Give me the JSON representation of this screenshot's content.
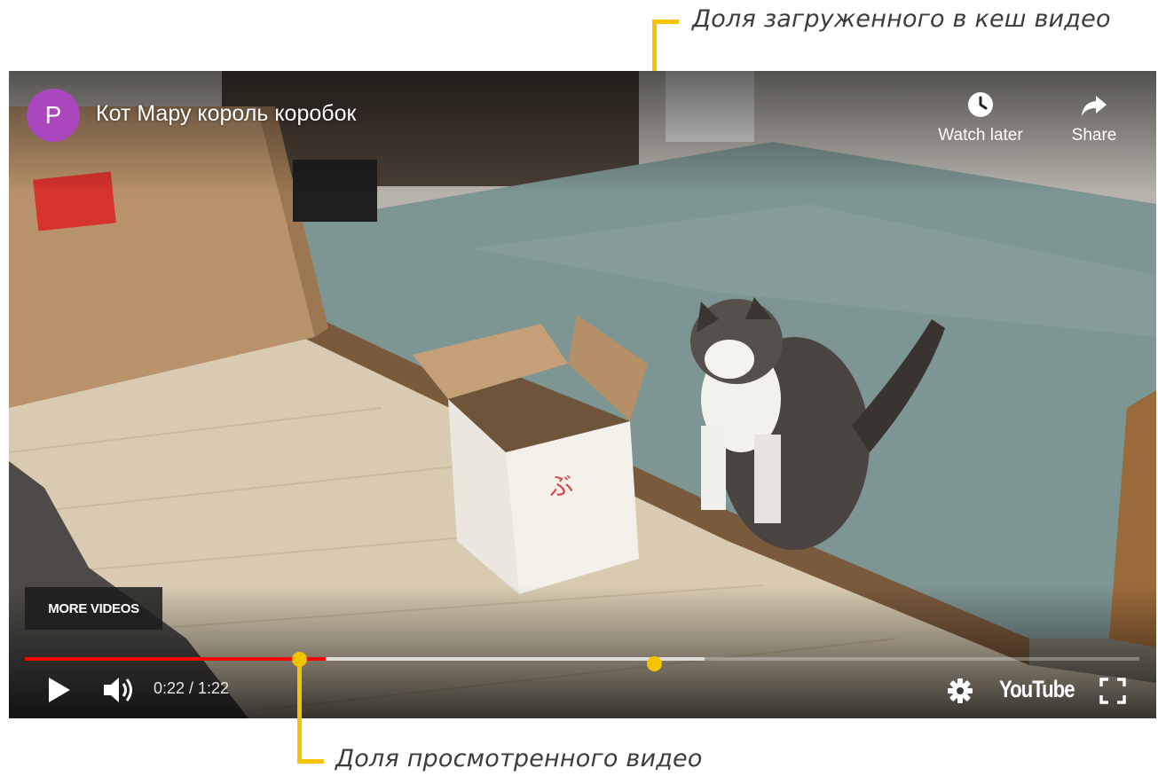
{
  "annotations": {
    "cached_label": "Доля загруженного в кеш видео",
    "watched_label": "Доля просмотренного видео",
    "color": "#f5c400"
  },
  "player": {
    "channel_initial": "P",
    "avatar_color": "#ab47bc",
    "title": "Кот Мару король коробок",
    "watch_later_label": "Watch later",
    "watch_later_icon": "clock-icon",
    "share_label": "Share",
    "share_icon": "share-arrow-icon",
    "more_videos_label": "MORE VIDEOS",
    "progress": {
      "played_fraction": 0.27,
      "loaded_fraction": 0.61,
      "played_color": "#ff0000"
    },
    "time_display": "0:22 / 1:22",
    "logo_text": "YouTube",
    "controls": {
      "play_icon": "play-icon",
      "volume_icon": "volume-icon",
      "settings_icon": "gear-icon",
      "fullscreen_icon": "fullscreen-icon"
    }
  }
}
